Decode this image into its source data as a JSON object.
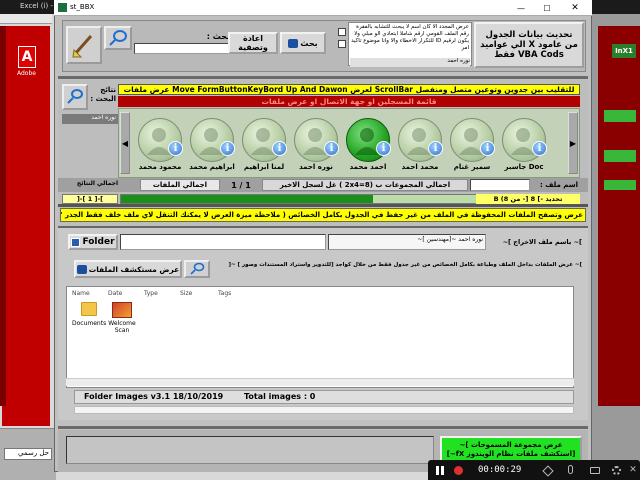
{
  "background_app": {
    "title": "Excel (i) - Excel",
    "adobe_label": "Adobe",
    "left_label": "حل رسمي",
    "right_header": "InX1"
  },
  "window": {
    "title": "st_BBX",
    "controls": {
      "minimize": "—",
      "maximize": "☐",
      "close": "✕"
    }
  },
  "top": {
    "update_button": "تحديث بيانات الجدول من عامود X الي عواميد VBA Cods فقط",
    "notice_text": "عرض المجدد الا كان اسم لا يبحث للتشابه بالفقرة رقم الملف القومي ارقم شاملا ابتعادي الو مبلي ولا يكون لرقيم ID للتكرار الاخطاء والا وانا موضوع تاكيد امر",
    "notice_sub": "نوره احمد",
    "search_label": "بحث :",
    "search_value": "نوره",
    "search_button": "بحث",
    "reset_button": "اعادة وتصفية"
  },
  "nav": {
    "results_label": "نتائج البحث :",
    "results_value": "نوره احمد",
    "banner_yellow": "للتقليب بين جدوين وتوعين متصل ومنفصل ScrollBar لعرض Move FormButtonKeyBord Up And Dawon عرض ملفات",
    "banner_red": "قائمة المسجلين او جهة الاتصال او عرض ملفات"
  },
  "people": [
    {
      "label": "محمود محمد",
      "selected": false
    },
    {
      "label": "ابراهيم محمد",
      "selected": false
    },
    {
      "label": "لمنا ابراهيم",
      "selected": false
    },
    {
      "label": "نوره احمد",
      "selected": false
    },
    {
      "label": "احمد محمد",
      "selected": true
    },
    {
      "label": "محمد احمد",
      "selected": false
    },
    {
      "label": "سمير غنام",
      "selected": false
    },
    {
      "label": "جاسبر Doc",
      "selected": false
    }
  ],
  "stats": {
    "files_total_label": "اجمالي الملفات",
    "pager": "1 / 1",
    "groups_label": "اجمالي المجموعات ب (8=2x4 ) غل لسجل الاخير",
    "file_name_label": "اسم ملف :",
    "results_total_label": "اجمالي النتائج",
    "results_total_value": "]-[ 1 ]-[",
    "progress_text": "تحديد -] 8 [- من B (8",
    "progress_fraction": 0.55
  },
  "hint_text": "عرض وتصفح الملفات المحفوظة في الملف من غير حفظ في الجدول بكامل الخصائص ( ملاحظة ميزة العرض لا يمكنك التنقل لاي ملف خلف فقط الجذر \"مسار\" المحدد )_ ScrollBar",
  "folder": {
    "button": "Folder",
    "field_value": "",
    "path_label": "نوره احمد ~[مهندسين ]~",
    "output_label": "]~ باسم ملف الاخراج ]~",
    "explorer_button": "عرض مستكشف الملفات",
    "explorer_hint": "]~ عرض الملفات بداخل الملف وطباعة بكامل الخصائص من غير جدول فقط من خلال كواجد [للتدوير واستراد المستندات وصور ] ~["
  },
  "explorer": {
    "columns": [
      "Name",
      "Date",
      "Type",
      "Size",
      "Tags"
    ],
    "items": [
      {
        "name": "Documents",
        "kind": "folder"
      },
      {
        "name": "Welcome Scan",
        "kind": "image"
      }
    ]
  },
  "footer": {
    "version": "Folder Images v3.1  18/10/2019",
    "total_images": "Total images : 0"
  },
  "bottom": {
    "green_button": "عرض مجموعة المسموحات ]~ [استكشف ملفات نظام الويندوز fX~]"
  },
  "recorder": {
    "time": "00:00:29"
  },
  "colors": {
    "accent_yellow": "#ffff00",
    "accent_red": "#ff2b2b",
    "accent_green": "#22cc22",
    "dark_red_bg": "#b00000"
  }
}
